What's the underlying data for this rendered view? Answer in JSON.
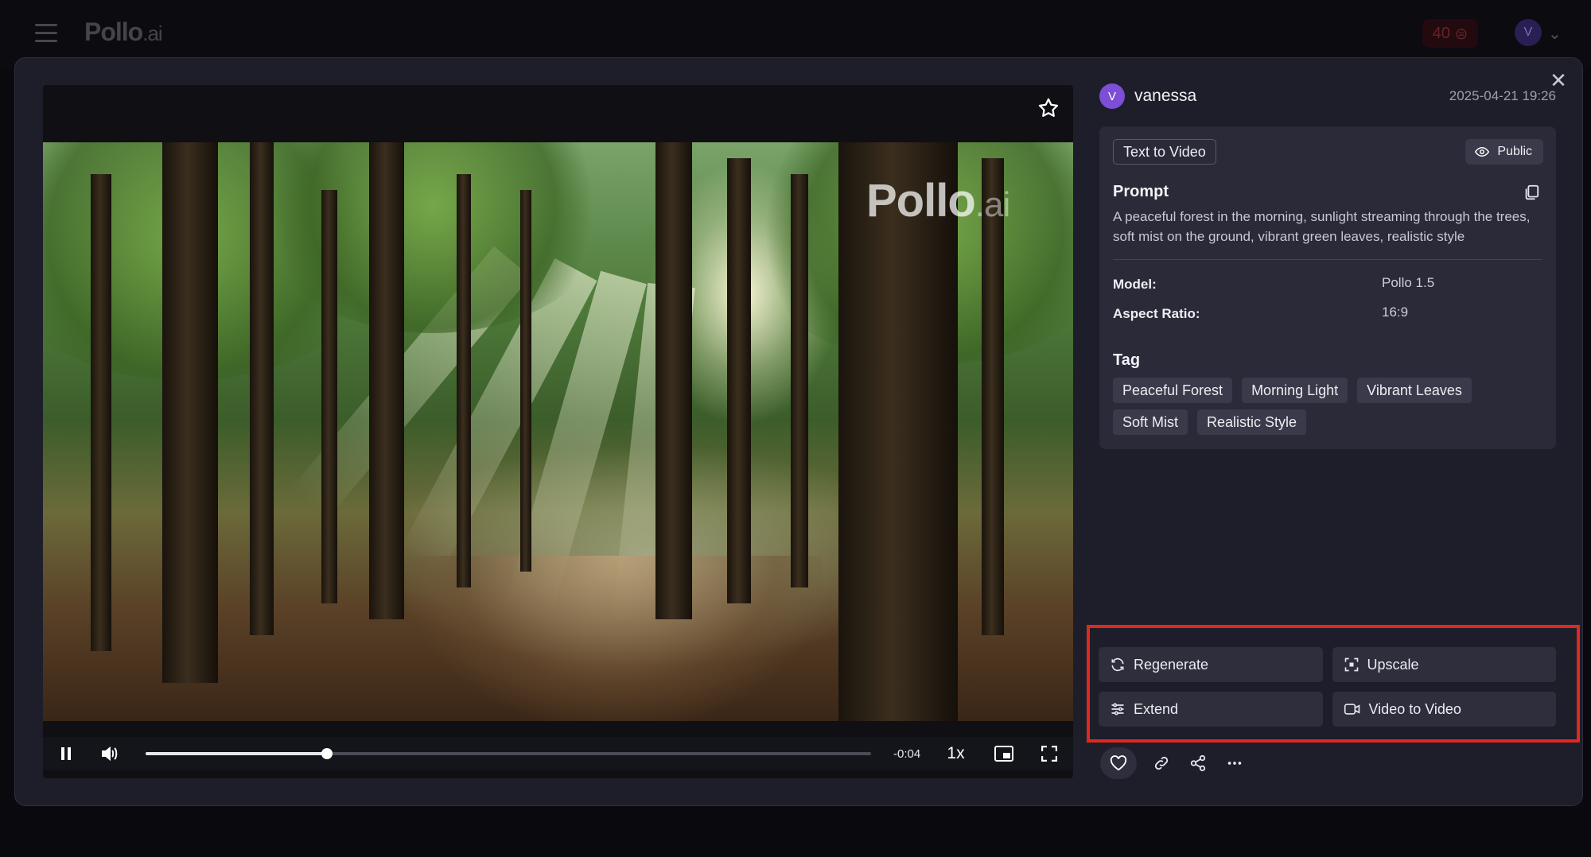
{
  "app": {
    "logo_main": "Pollo",
    "logo_suffix": ".ai",
    "credits": "40",
    "user_initial": "V"
  },
  "video": {
    "watermark_main": "Pollo",
    "watermark_suffix": ".ai",
    "time_remaining": "-0:04",
    "speed": "1x",
    "progress_fraction": 0.25
  },
  "details": {
    "avatar_initial": "V",
    "username": "vanessa",
    "timestamp": "2025-04-21 19:26",
    "type_badge": "Text to Video",
    "visibility": "Public",
    "prompt_title": "Prompt",
    "prompt_text": "A peaceful forest in the morning, sunlight streaming through the trees, soft mist on the ground, vibrant green leaves, realistic style",
    "model_label": "Model:",
    "model_value": "Pollo 1.5",
    "aspect_label": "Aspect Ratio:",
    "aspect_value": "16:9",
    "tag_title": "Tag",
    "tags": [
      "Peaceful Forest",
      "Morning Light",
      "Vibrant Leaves",
      "Soft Mist",
      "Realistic Style"
    ]
  },
  "actions": {
    "regenerate": "Regenerate",
    "upscale": "Upscale",
    "extend": "Extend",
    "video_to_video": "Video to Video"
  },
  "colors": {
    "highlight": "#e0281e",
    "avatar": "#7c4fd6"
  }
}
